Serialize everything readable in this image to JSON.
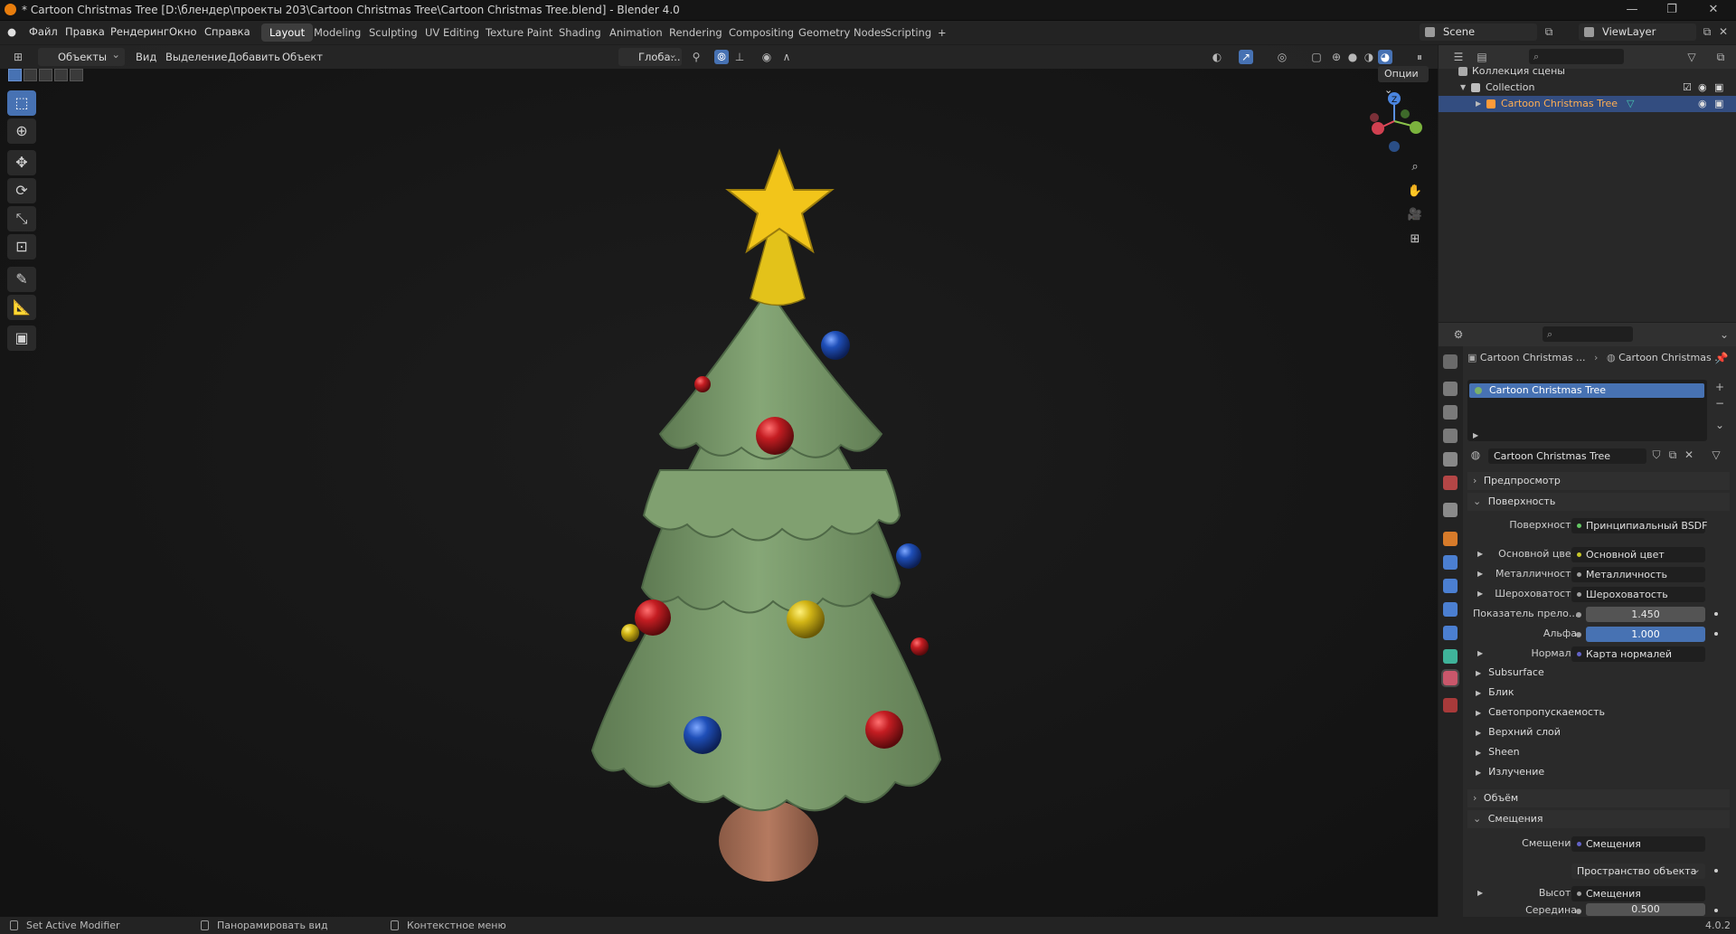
{
  "window": {
    "title": "* Cartoon Christmas Tree [D:\\блендер\\проекты 203\\Cartoon Christmas Tree\\Cartoon Christmas Tree.blend] - Blender 4.0",
    "minimize": "—",
    "maximize": "❐",
    "close": "✕"
  },
  "menu": {
    "file": "Файл",
    "edit": "Правка",
    "render": "Рендеринг",
    "window": "Окно",
    "help": "Справка"
  },
  "workspaces": [
    "Layout",
    "Modeling",
    "Sculpting",
    "UV Editing",
    "Texture Paint",
    "Shading",
    "Animation",
    "Rendering",
    "Compositing",
    "Geometry Nodes",
    "Scripting",
    "+"
  ],
  "scene": {
    "scene_name": "Scene",
    "view_layer": "ViewLayer"
  },
  "viewport_header": {
    "mode": "Объекты",
    "view": "Вид",
    "select": "Выделение",
    "add": "Добавить",
    "object": "Объект",
    "transform_orientation": "Глоба...",
    "options": "Опции"
  },
  "gizmo": {
    "z": "Z"
  },
  "outliner": {
    "scene_collection": "Коллекция сцены",
    "collection": "Collection",
    "object": "Cartoon Christmas Tree"
  },
  "properties": {
    "breadcrumb_object": "Cartoon Christmas ...",
    "breadcrumb_material": "Cartoon Christmas ...",
    "material_slot": "Cartoon Christmas Tree",
    "material_name": "Cartoon Christmas Tree",
    "sections": {
      "preview": "Предпросмотр",
      "surface": "Поверхность",
      "volume": "Объём",
      "displacement": "Смещения"
    },
    "surface_rows": [
      {
        "label": "Поверхность",
        "value": "Принципиальный BSDF",
        "color": "#63c763"
      },
      {
        "label": "Основной цвет",
        "value": "Основной цвет",
        "color": "#c7c729"
      },
      {
        "label": "Металличность",
        "value": "Металличность",
        "color": "#a1a1a1"
      },
      {
        "label": "Шероховатость",
        "value": "Шероховатость",
        "color": "#a1a1a1"
      }
    ],
    "ior": {
      "label": "Показатель прело...",
      "value": "1.450"
    },
    "alpha": {
      "label": "Альфа",
      "value": "1.000"
    },
    "normal": {
      "label": "Нормаль",
      "value": "Карта нормалей",
      "color": "#6363c7"
    },
    "subsections": [
      "Subsurface",
      "Блик",
      "Светопропускаемость",
      "Верхний слой",
      "Sheen",
      "Излучение"
    ],
    "displacement_rows": {
      "displacement_label": "Смещения",
      "displacement_value": "Смещения",
      "space": "Пространство объекта",
      "height_label": "Высота",
      "height_value": "Смещения",
      "midlevel_label": "Середина",
      "midlevel_value": "0.500"
    }
  },
  "statusbar": {
    "modifier": "Set Active Modifier",
    "pan": "Панорамировать вид",
    "context": "Контекстное меню",
    "version": "4.0.2"
  },
  "colors": {
    "accent": "#4772b3",
    "selected_text": "#ffae52",
    "tree": "#7a9c6a",
    "star": "#f2c51a"
  }
}
